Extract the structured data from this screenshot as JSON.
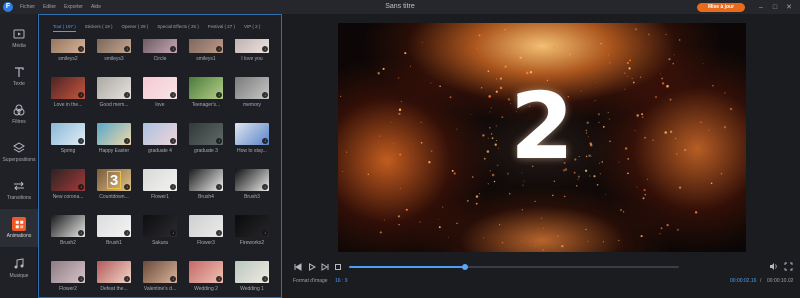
{
  "titlebar": {
    "logo": "F",
    "menu": [
      "Fichier",
      "Editer",
      "Exporter",
      "Aide"
    ],
    "title": "Sans titre",
    "upgrade": "Mise à jour",
    "saved": "Enregistré récemment 22:07"
  },
  "sidebar": {
    "items": [
      {
        "label": "Média",
        "icon": "media-icon"
      },
      {
        "label": "Texte",
        "icon": "text-icon"
      },
      {
        "label": "Filtres",
        "icon": "filters-icon"
      },
      {
        "label": "Superpositions",
        "icon": "overlays-icon"
      },
      {
        "label": "Transitions",
        "icon": "transitions-icon"
      },
      {
        "label": "Animations",
        "icon": "animations-icon",
        "active": true
      },
      {
        "label": "Musique",
        "icon": "music-icon"
      }
    ]
  },
  "tabs": [
    "Tout ( 197 )",
    "Stickers ( 19 )",
    "Opener ( 29 )",
    "Special Effects ( 25 )",
    "Festival ( 27 )",
    "VIP ( 2 )"
  ],
  "thumbnails": [
    {
      "name": "smileys2",
      "colors": [
        "#8a6b55",
        "#d9b49a"
      ]
    },
    {
      "name": "smileys3",
      "colors": [
        "#6d5c52",
        "#c8a890"
      ]
    },
    {
      "name": "Circle",
      "colors": [
        "#5a4f56",
        "#c9a7b5"
      ]
    },
    {
      "name": "smileys1",
      "colors": [
        "#72605a",
        "#bf9a86"
      ]
    },
    {
      "name": "I love you",
      "colors": [
        "#b8a9a8",
        "#ece4e1"
      ]
    },
    {
      "name": "Love in the...",
      "colors": [
        "#4c2424",
        "#c9563e"
      ]
    },
    {
      "name": "Good mem...",
      "colors": [
        "#aaa8a2",
        "#e7e4dd"
      ]
    },
    {
      "name": "love",
      "colors": [
        "#f5c8d2",
        "#f7e6ea"
      ]
    },
    {
      "name": "Teenager's...",
      "colors": [
        "#4b7a3a",
        "#b6d08a"
      ]
    },
    {
      "name": "memory",
      "colors": [
        "#7a7a7a",
        "#c8c8c8"
      ]
    },
    {
      "name": "Spring",
      "colors": [
        "#8ab8d8",
        "#e2eef6"
      ]
    },
    {
      "name": "Happy Easter",
      "colors": [
        "#58a7c9",
        "#f0d9a8"
      ]
    },
    {
      "name": "graduate 4",
      "colors": [
        "#a9c3df",
        "#f2d3dc"
      ]
    },
    {
      "name": "graduate 3",
      "colors": [
        "#33393a",
        "#5f6a66"
      ]
    },
    {
      "name": "How to stay...",
      "colors": [
        "#dfe6f1",
        "#5a84c7"
      ]
    },
    {
      "name": "New corona...",
      "colors": [
        "#2c2222",
        "#a43a3a"
      ]
    },
    {
      "name": "Countdown...",
      "colors": [
        "#7a5a3a",
        "#e2c48a"
      ],
      "badge": "3"
    },
    {
      "name": "Flower1",
      "colors": [
        "#d8d8d6",
        "#f3f3f1"
      ]
    },
    {
      "name": "Brush4",
      "colors": [
        "#1a1a1a",
        "#f2f2f2"
      ]
    },
    {
      "name": "Brush3",
      "colors": [
        "#111111",
        "#ececec"
      ]
    },
    {
      "name": "Brush2",
      "colors": [
        "#1a1a1a",
        "#e8e8e8"
      ]
    },
    {
      "name": "Brush1",
      "colors": [
        "#dcdcdc",
        "#f4f4f4"
      ]
    },
    {
      "name": "Sakura",
      "colors": [
        "#0e0e10",
        "#2a2a30"
      ]
    },
    {
      "name": "Flower3",
      "colors": [
        "#cfcfcf",
        "#ebebeb"
      ]
    },
    {
      "name": "Fireworks2",
      "colors": [
        "#0b0b0c",
        "#262628"
      ]
    },
    {
      "name": "Flower2",
      "colors": [
        "#8c7b80",
        "#d8c5cc"
      ]
    },
    {
      "name": "Defeat the...",
      "colors": [
        "#b35a5a",
        "#f1d7c9"
      ]
    },
    {
      "name": "Valentine's d...",
      "colors": [
        "#6a4a3a",
        "#d9b49a"
      ]
    },
    {
      "name": "Wedding 2",
      "colors": [
        "#c46a66",
        "#f0c1b5"
      ]
    },
    {
      "name": "Wedding 1",
      "colors": [
        "#b9c7c0",
        "#f1ebe0"
      ]
    }
  ],
  "preview": {
    "number": "2",
    "progress": 0.35
  },
  "footer": {
    "ratio_label": "Format d'image",
    "ratio_value": "16 : 9",
    "time_current": "00:00:02.16",
    "time_sep": "/",
    "time_total": "00:00:10.02"
  },
  "colors": {
    "accent": "#4d9ef5",
    "upgrade": "#e86a1c",
    "active_tab": "#f05a28"
  }
}
